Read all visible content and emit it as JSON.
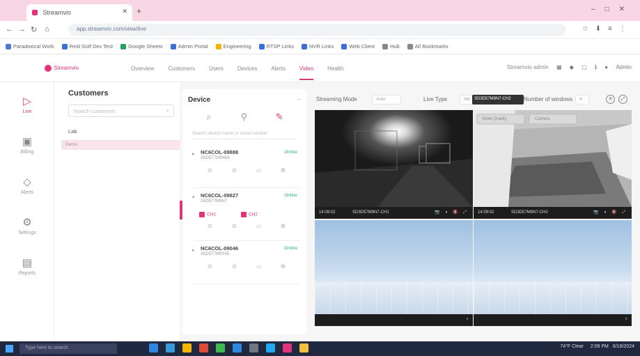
{
  "browser": {
    "tab_title": "Streamvio",
    "url": "app.streamvio.com/view/live",
    "bookmarks": [
      {
        "label": "Paradoxical Work",
        "color": "#4b7bd3"
      },
      {
        "label": "Reid Golf Dev Test",
        "color": "#3a6fd8"
      },
      {
        "label": "Google Sheets",
        "color": "#1fa463"
      },
      {
        "label": "Admin Portal",
        "color": "#3a6fd8"
      },
      {
        "label": "Engineering",
        "color": "#f4b400"
      },
      {
        "label": "RTSP Links",
        "color": "#3a6fd8"
      },
      {
        "label": "NVR Links",
        "color": "#3a6fd8"
      },
      {
        "label": "Web Client",
        "color": "#3a6fd8"
      },
      {
        "label": "Hub",
        "color": "#888888"
      },
      {
        "label": "All Bookmarks",
        "color": "#888888"
      }
    ]
  },
  "header": {
    "logo_text": "Streamvio",
    "nav": [
      "Overview",
      "Customers",
      "Users",
      "Devices",
      "Alerts",
      "Video",
      "Health"
    ],
    "active_nav": "Video",
    "right_text": "Streamvio admin",
    "user_label": "Admin"
  },
  "rail": [
    {
      "label": "Live",
      "icon": "live-icon",
      "active": true
    },
    {
      "label": "Billing",
      "icon": "billing-icon",
      "active": false
    },
    {
      "label": "Alerts",
      "icon": "alerts-icon",
      "active": false
    },
    {
      "label": "Settings",
      "icon": "settings-icon",
      "active": false
    },
    {
      "label": "Reports",
      "icon": "reports-icon",
      "active": false
    }
  ],
  "customers": {
    "title": "Customers",
    "search_placeholder": "Search customers",
    "rows": [
      "Lab",
      "Demo"
    ],
    "selected_index": 1
  },
  "device_panel": {
    "title": "Device",
    "search_placeholder": "Search device name or serial number",
    "devices": [
      {
        "name": "NC6COL-09888",
        "serial": "S5D5T7M9N8A",
        "status": "Online",
        "expanded": false
      },
      {
        "name": "NC6COL-09827",
        "serial": "S5D5T7M9N7",
        "status": "Online",
        "expanded": true,
        "channels": [
          "CH1",
          "CH2"
        ]
      },
      {
        "name": "NC6COL-09046",
        "serial": "S5D5T7M9Y45",
        "status": "Online",
        "expanded": false
      }
    ]
  },
  "streaming": {
    "mode_label": "Streaming Mode",
    "mode_value": "Auto",
    "live_type_label": "Live Type",
    "live_type_value": "Hd",
    "tooltip": "SD3D57M9N7-CH2",
    "windows_label": "Number of windows",
    "windows_value": "4",
    "tiles": [
      {
        "kind": "night",
        "left_label": "14:09:02",
        "mid_label": "SD3D57M9N7-CH1"
      },
      {
        "kind": "indoor",
        "left_label": "14:09:02",
        "mid_label": "SD3D57M9N7-CH2"
      },
      {
        "kind": "empty"
      },
      {
        "kind": "empty"
      }
    ],
    "overlay_pills": [
      "Video Quality",
      "Camera"
    ]
  },
  "taskbar": {
    "search_placeholder": "Type here to search",
    "weather": "74°F Clear",
    "time": "2:09 PM",
    "date": "6/18/2024",
    "app_colors": [
      "#2e86de",
      "#3a9ad9",
      "#f4b400",
      "#e04b39",
      "#3fb950",
      "#2e86de",
      "#6e7681",
      "#22a7f0",
      "#e0357a",
      "#f0c040"
    ]
  }
}
